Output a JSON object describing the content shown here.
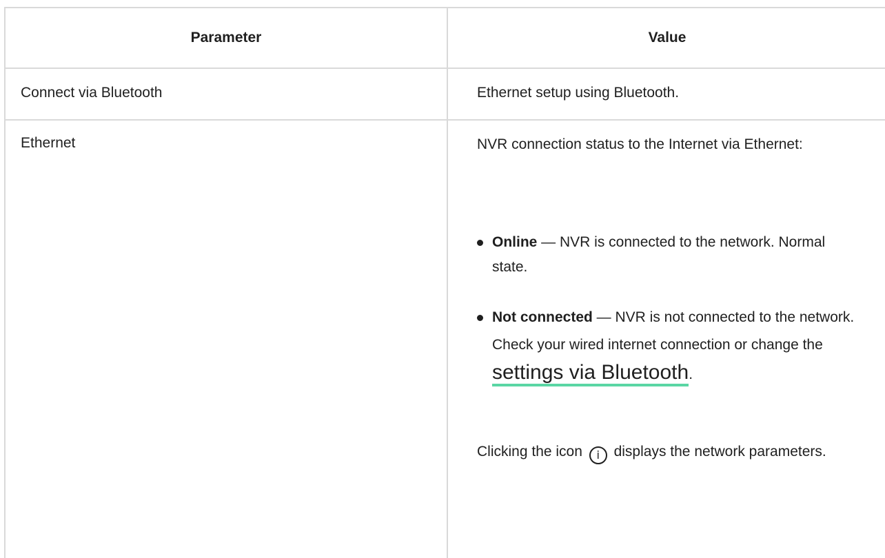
{
  "table": {
    "headers": {
      "parameter": "Parameter",
      "value": "Value"
    },
    "rows": [
      {
        "parameter": "Connect via Bluetooth",
        "value": "Ethernet setup using Bluetooth."
      },
      {
        "parameter": "Ethernet",
        "value_intro": "NVR connection status to the Internet via Ethernet:",
        "statuses": [
          {
            "term": "Online",
            "description": " — NVR is connected to the network. Normal state."
          },
          {
            "term": "Not connected",
            "description": " — NVR is not connected to the network. Check your wired internet connection or change the ",
            "link_text": "settings via Bluetooth",
            "suffix": "."
          }
        ],
        "note_before_icon": "Clicking the icon ",
        "note_icon_glyph": "i",
        "note_icon_name": "info-icon",
        "note_after_icon": " displays the network parameters."
      }
    ]
  },
  "colors": {
    "border": "#d9d9d9",
    "link_underline": "#5ad6a4",
    "text": "#1f1f1f"
  }
}
